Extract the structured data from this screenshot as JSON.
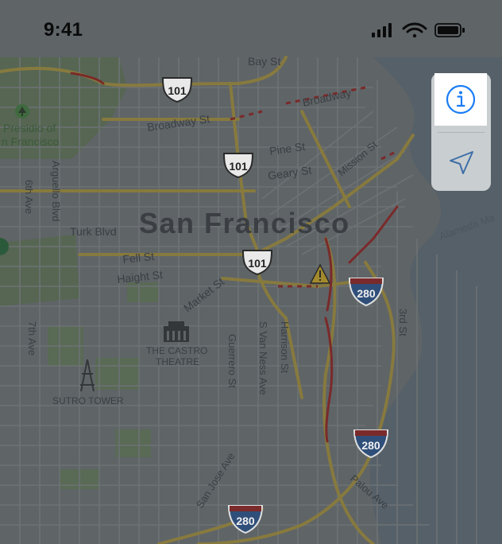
{
  "status_bar": {
    "time": "9:41"
  },
  "map": {
    "city": "San Francisco",
    "labels": {
      "bay_st": "Bay St",
      "broadway": "Broadway",
      "broadway_st": "Broadway St",
      "pine_st": "Pine St",
      "geary_st": "Geary St",
      "mission_st": "Mission St",
      "presidio_line1": "Presidio of",
      "presidio_line2": "n Francisco",
      "arguello": "Arguello Blvd",
      "sixth_ave": "6th Ave",
      "turk_blvd": "Turk Blvd",
      "fell_st": "Fell St",
      "haight_st": "Haight St",
      "market_st": "Market St",
      "alameda": "Alameda Ma",
      "seventh_ave": "7th Ave",
      "castro_line1": "THE CASTRO",
      "castro_line2": "THEATRE",
      "guerrero": "Guerrero St",
      "van_ness": "S Van Ness Ave",
      "harrison": "Harrison St",
      "third_st": "3rd St",
      "sutro": "SUTRO TOWER",
      "san_jose": "San Jose Ave",
      "palou": "Palou Ave"
    },
    "shields": {
      "us101": "101",
      "i280": "280"
    }
  },
  "controls": {
    "info_icon": "info-icon",
    "location_icon": "location-arrow-icon"
  }
}
